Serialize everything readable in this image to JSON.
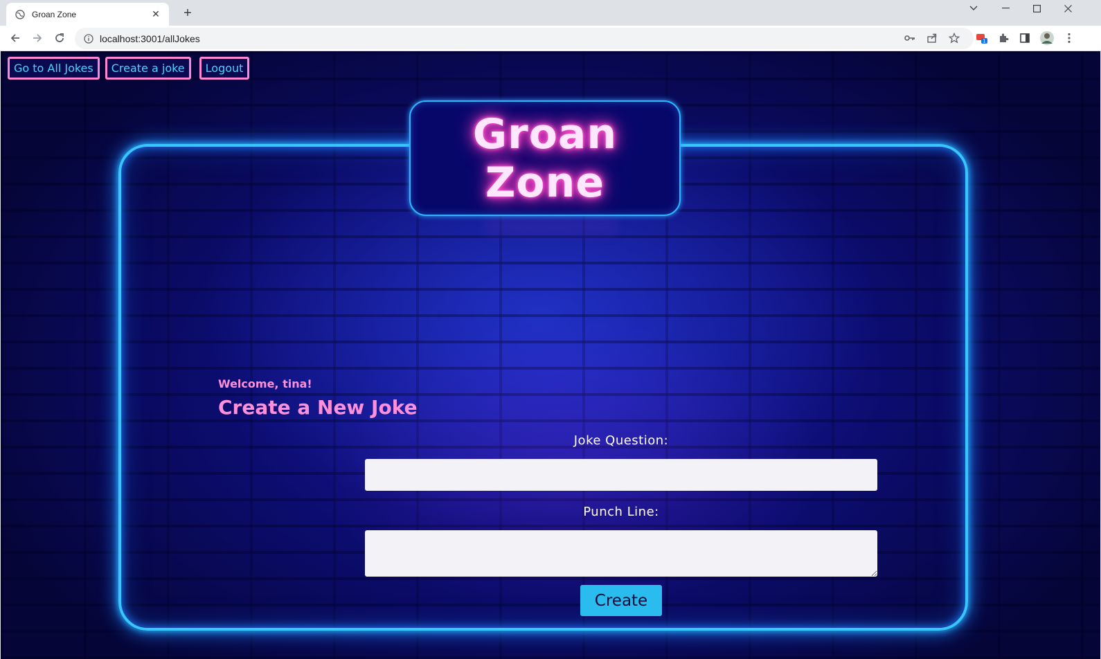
{
  "browser": {
    "tab_title": "Groan Zone",
    "tab_close": "✕",
    "new_tab": "+",
    "url": "localhost:3001/allJokes",
    "extension_badge": "1"
  },
  "nav": {
    "all_jokes": "Go to All Jokes",
    "create_joke": "Create a joke",
    "logout": "Logout"
  },
  "logo": {
    "line1": "Groan",
    "line2": "Zone"
  },
  "page": {
    "welcome": "Welcome, tina!",
    "heading": "Create a New Joke"
  },
  "form": {
    "question_label": "Joke Question:",
    "question_value": "",
    "punchline_label": "Punch Line:",
    "punchline_value": "",
    "submit_label": "Create"
  },
  "colors": {
    "neon_blue": "#39c6ff",
    "neon_pink": "#ff86d5",
    "button_cyan": "#2bbcef",
    "background": "#0c0c6e"
  }
}
